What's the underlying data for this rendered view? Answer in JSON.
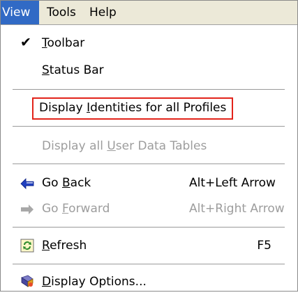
{
  "menubar": {
    "items": [
      {
        "label": "View",
        "active": true
      },
      {
        "label": "Tools",
        "active": false
      },
      {
        "label": "Help",
        "active": false
      }
    ]
  },
  "menu": {
    "toolbar": {
      "pre": "",
      "mnemonic": "T",
      "post": "oolbar",
      "checked": true
    },
    "status_bar": {
      "pre": "",
      "mnemonic": "S",
      "post": "tatus Bar"
    },
    "display_identities": {
      "pre": "Display ",
      "mnemonic": "I",
      "post": "dentities for all Profiles"
    },
    "display_user_tables": {
      "pre": "Display all ",
      "mnemonic": "U",
      "post": "ser Data Tables",
      "disabled": true
    },
    "go_back": {
      "pre": "Go ",
      "mnemonic": "B",
      "post": "ack",
      "shortcut": "Alt+Left Arrow",
      "icon": "arrow-left-icon"
    },
    "go_forward": {
      "pre": "Go ",
      "mnemonic": "F",
      "post": "orward",
      "shortcut": "Alt+Right Arrow",
      "icon": "arrow-right-icon",
      "disabled": true
    },
    "refresh": {
      "pre": "",
      "mnemonic": "R",
      "post": "efresh",
      "shortcut": "F5",
      "icon": "refresh-icon"
    },
    "display_options": {
      "pre": "",
      "mnemonic": "D",
      "post": "isplay Options...",
      "icon": "display-options-icon"
    }
  },
  "colors": {
    "menubar_bg": "#ece9d8",
    "active_bg": "#316ac5",
    "highlight_box": "#e2231a",
    "disabled_text": "#9d9d9d",
    "back_arrow": "#1f3fbf",
    "refresh_green": "#2e8b2e"
  }
}
